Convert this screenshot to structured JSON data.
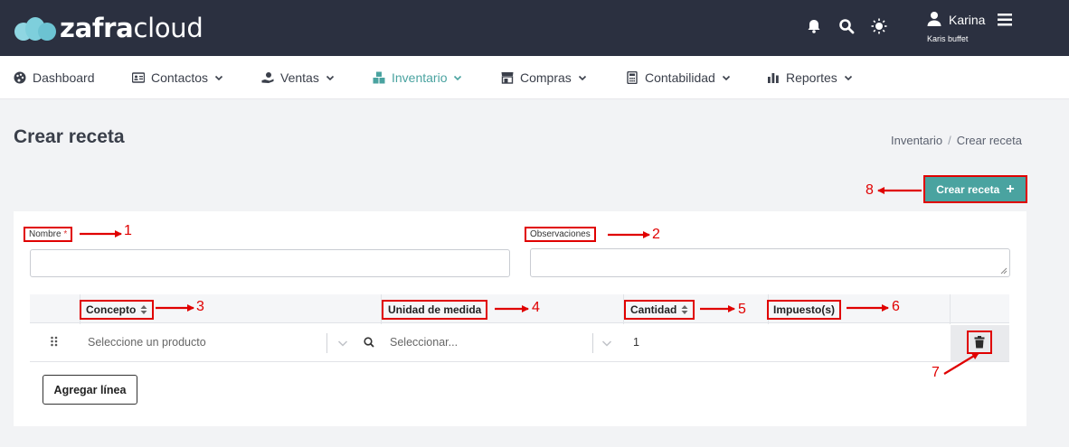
{
  "header": {
    "logo_text_bold": "zafra",
    "logo_text_light": "cloud",
    "user_name": "Karina",
    "user_company": "Karis buffet"
  },
  "nav": [
    {
      "label": "Dashboard",
      "icon": "palette-icon"
    },
    {
      "label": "Contactos",
      "icon": "id-card-icon"
    },
    {
      "label": "Ventas",
      "icon": "hand-holding-dollar-icon"
    },
    {
      "label": "Inventario",
      "icon": "boxes-icon",
      "active": true
    },
    {
      "label": "Compras",
      "icon": "store-icon"
    },
    {
      "label": "Contabilidad",
      "icon": "calculator-icon"
    },
    {
      "label": "Reportes",
      "icon": "bar-chart-icon"
    }
  ],
  "page": {
    "title": "Crear receta",
    "breadcrumb": [
      "Inventario",
      "Crear receta"
    ],
    "create_button": "Crear receta"
  },
  "form": {
    "name_label": "Nombre",
    "required_mark": "*",
    "observations_label": "Observaciones"
  },
  "table": {
    "headers": [
      "Concepto",
      "Unidad de medida",
      "Cantidad",
      "Impuesto(s)"
    ],
    "row": {
      "product_placeholder": "Seleccione un producto",
      "unit_placeholder": "Seleccionar...",
      "quantity": "1"
    },
    "add_line": "Agregar línea"
  },
  "annotations": [
    "1",
    "2",
    "3",
    "4",
    "5",
    "6",
    "7",
    "8"
  ],
  "colors": {
    "topbar": "#2b3040",
    "accent": "#4aa3a0",
    "annotation": "#e00000"
  }
}
